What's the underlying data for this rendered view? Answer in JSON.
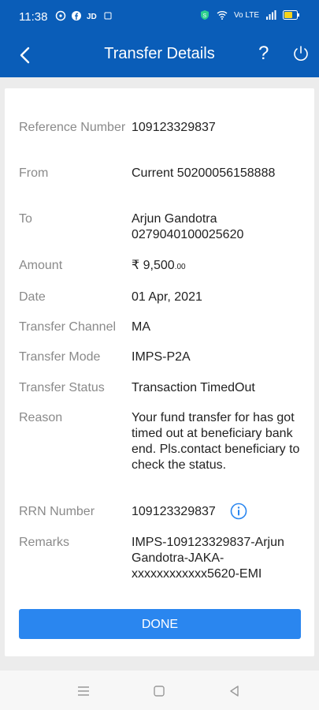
{
  "status": {
    "time": "11:38",
    "left_icons": [
      "whatsapp-icon",
      "facebook-icon",
      "jd-icon",
      "notification-icon"
    ],
    "right_icons": [
      "security-shield-icon",
      "wifi-icon",
      "volte-icon",
      "signal-icon",
      "battery-icon"
    ],
    "volte_text": "Vo LTE"
  },
  "header": {
    "title": "Transfer Details",
    "help_label": "?"
  },
  "details": [
    {
      "label": "Reference Number",
      "value": "109123329837"
    },
    {
      "label": "From",
      "value": "Current 50200056158888"
    },
    {
      "label": "To",
      "value": "Arjun Gandotra 0279040100025620"
    },
    {
      "label": "Amount",
      "value": "₹ 9,500",
      "value_suffix": ".00"
    },
    {
      "label": "Date",
      "value": "01 Apr, 2021"
    },
    {
      "label": "Transfer Channel",
      "value": "MA"
    },
    {
      "label": "Transfer Mode",
      "value": "IMPS-P2A"
    },
    {
      "label": "Transfer Status",
      "value": "Transaction TimedOut"
    },
    {
      "label": "Reason",
      "value": "Your fund transfer for has got timed out at beneficiary bank end. Pls.contact beneficiary to check the status."
    },
    {
      "label": "RRN Number",
      "value": "109123329837"
    },
    {
      "label": "Remarks",
      "value": "IMPS-109123329837-Arjun Gandotra-JAKA-xxxxxxxxxxxx5620-EMI"
    }
  ],
  "actions": {
    "done_label": "DONE"
  },
  "colors": {
    "primary": "#0a5db8",
    "button": "#2a86ef",
    "info_icon": "#2a86ef",
    "label_text": "#8a8a8a"
  }
}
